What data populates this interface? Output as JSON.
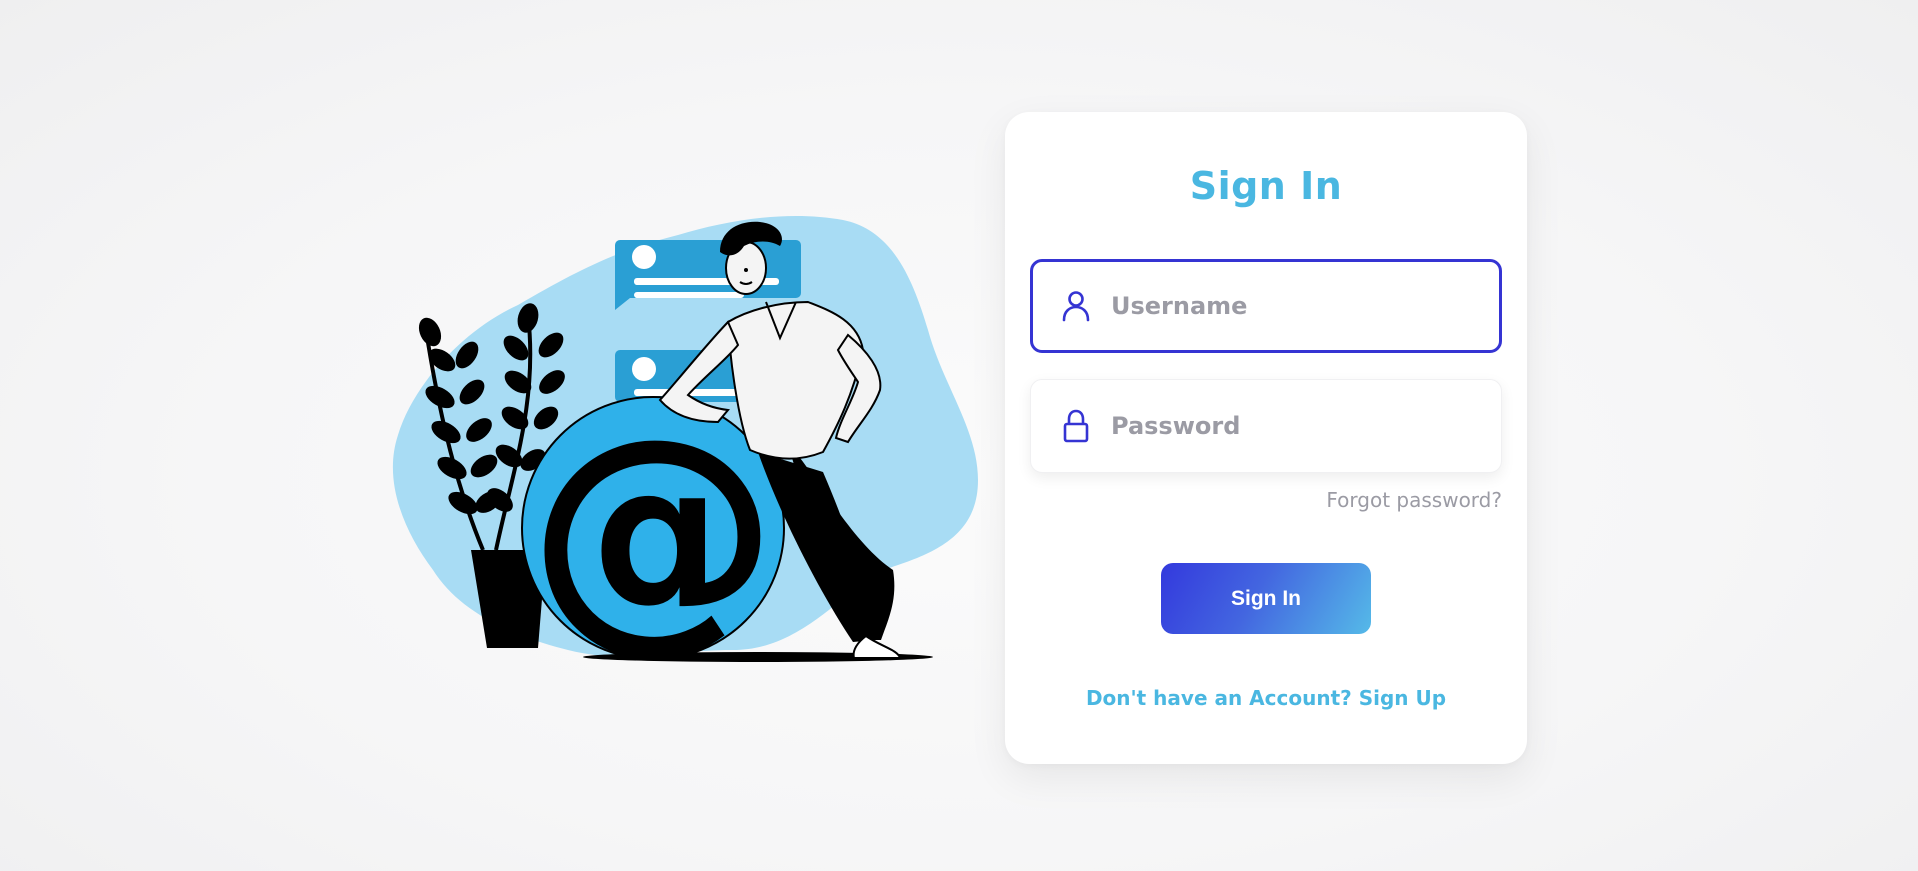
{
  "form": {
    "title": "Sign In",
    "username": {
      "value": "",
      "placeholder": "Username"
    },
    "password": {
      "value": "",
      "placeholder": "Password"
    },
    "forgot_label": "Forgot password?",
    "submit_label": "Sign In",
    "signup_label": "Don't have an Account? Sign Up"
  },
  "icons": {
    "username": "user-icon",
    "password": "lock-icon",
    "illustration": "email-at-sign-illustration"
  },
  "colors": {
    "accent": "#4ab7e1",
    "focus_border": "#3534d3",
    "button_gradient_start": "#3339dd",
    "button_gradient_end": "#55bae8",
    "muted_text": "#9b9ba4",
    "illustration_blob": "#a8dcf4",
    "illustration_circle": "#2fb1ea"
  }
}
